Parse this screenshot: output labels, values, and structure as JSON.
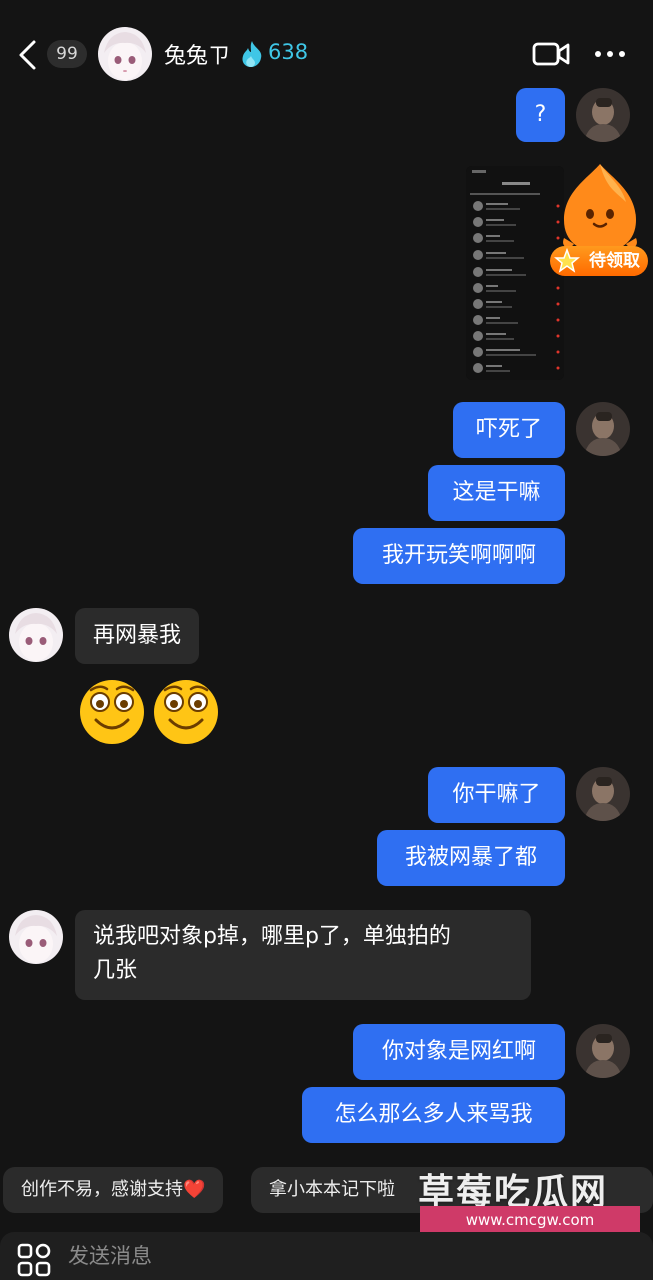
{
  "header": {
    "unread_count": "99",
    "contact_name": "兔兔ㄗ",
    "spark_count": "638"
  },
  "messages": [
    {
      "side": "me",
      "text": "?"
    },
    {
      "side": "me",
      "type": "image"
    },
    {
      "side": "me",
      "text": "吓死了"
    },
    {
      "side": "me",
      "text": "这是干嘛"
    },
    {
      "side": "me",
      "text": "我开玩笑啊啊啊"
    },
    {
      "side": "them",
      "text": "再网暴我"
    },
    {
      "side": "them",
      "type": "emoji",
      "emoji_names": [
        "sweet-smile-emoji",
        "sweet-smile-emoji"
      ]
    },
    {
      "side": "me",
      "text": "你干嘛了"
    },
    {
      "side": "me",
      "text": "我被网暴了都"
    },
    {
      "side": "them",
      "text_lines": [
        "说我吧对象p掉，哪里p了，单独拍的",
        "几张"
      ]
    },
    {
      "side": "me",
      "text": "你对象是网红啊"
    },
    {
      "side": "me",
      "text": "怎么那么多人来骂我"
    }
  ],
  "promo": {
    "tag": "待领取"
  },
  "quick_replies": [
    {
      "text": "创作不易，感谢支持",
      "emoji": "❤️"
    },
    {
      "text": "拿小本本记下啦"
    }
  ],
  "watermark": {
    "title": "草莓吃瓜网",
    "url": "www.cmcgw.com"
  },
  "composer": {
    "placeholder": "发送消息"
  },
  "colors": {
    "background": "#141414",
    "my_bubble": "#2f6ff2",
    "their_bubble": "#2b2b2b",
    "spark": "#3fc6e6"
  }
}
